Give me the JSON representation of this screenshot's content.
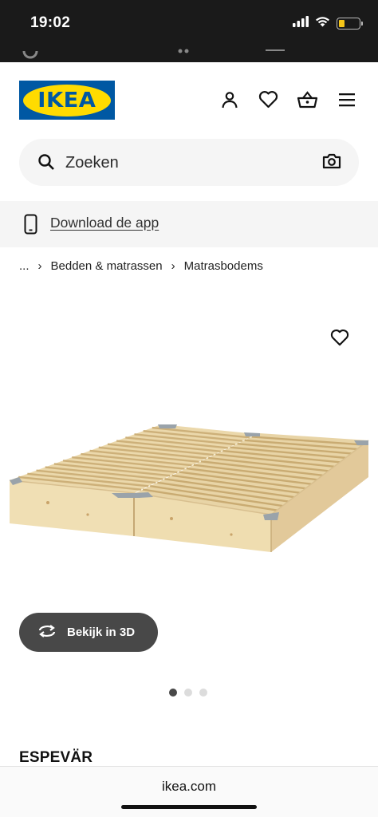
{
  "status_bar": {
    "time": "19:02",
    "battery_level": 0.3,
    "icons": [
      "signal-icon",
      "wifi-icon",
      "battery-icon"
    ]
  },
  "header": {
    "logo_text": "IKEA",
    "colors": {
      "brand_blue": "#0058a3",
      "brand_yellow": "#ffdb00"
    },
    "icons": [
      "account-icon",
      "heart-icon",
      "basket-icon",
      "menu-icon"
    ]
  },
  "search": {
    "placeholder": "Zoeken"
  },
  "app_banner": {
    "link_text": "Download de app"
  },
  "breadcrumb": {
    "items": [
      "...",
      "Bedden & matrassen",
      "Matrasbodems"
    ]
  },
  "product": {
    "view3d_label": "Bekijk in 3D",
    "image_count": 3,
    "active_image": 1,
    "name": "ESPEVÄR"
  },
  "browser": {
    "url": "ikea.com"
  }
}
